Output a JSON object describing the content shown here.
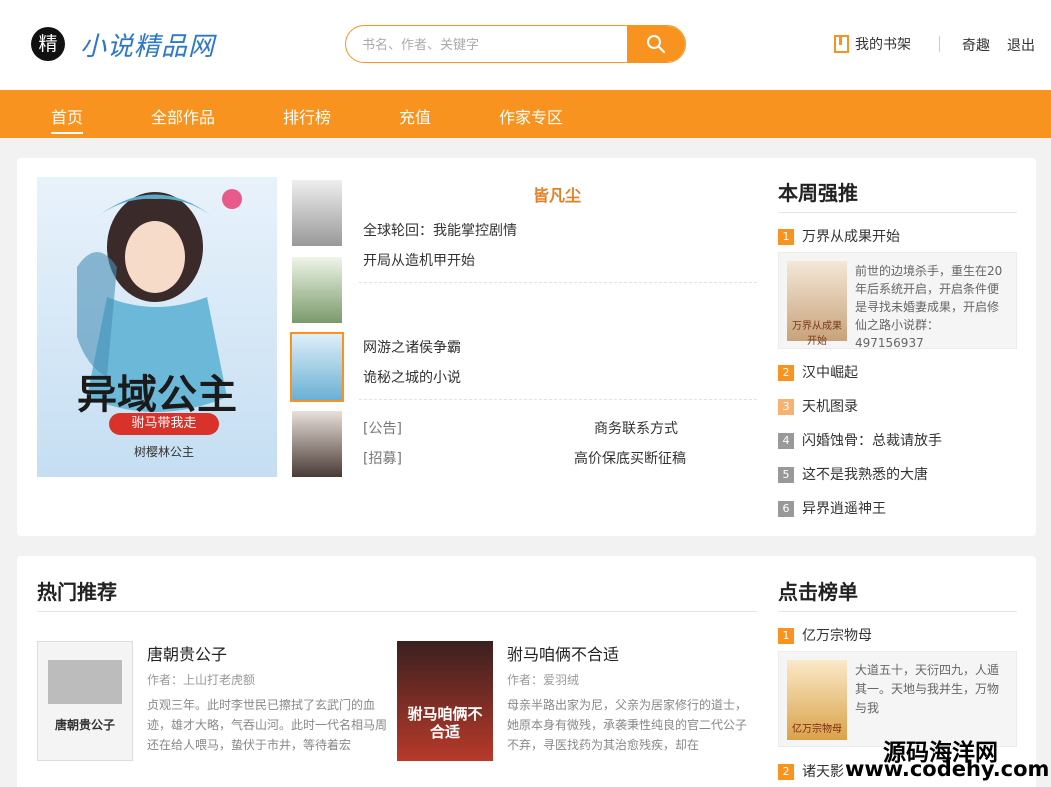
{
  "header": {
    "logo_char": "精",
    "site_name": "小说精品网",
    "search_placeholder": "书名、作者、关键字",
    "shelf_label": "我的书架",
    "username": "奇趣",
    "logout_label": "退出"
  },
  "nav": {
    "items": [
      "首页",
      "全部作品",
      "排行榜",
      "充值",
      "作家专区"
    ],
    "active": "首页"
  },
  "featured": {
    "title": "皆凡尘",
    "lines": [
      "全球轮回：我能掌控剧情",
      "开局从造机甲开始",
      "网游之诸侯争霸",
      "诡秘之城的小说",
      "[公告]",
      "商务联系方式",
      "[招募]",
      "高价保底买断征稿"
    ],
    "cover_text": "异域公主",
    "cover_subtitle": "驸马带我走",
    "cover_author": "树樱林公主"
  },
  "weekly": {
    "title": "本周强推",
    "items": [
      {
        "rank": "1",
        "name": "万界从成果开始",
        "desc": "前世的边境杀手，重生在20年后系统开启，开启条件便是寻找未婚妻成果，开启修仙之路小说群：497156937",
        "cover_text": "万界从成果开始"
      },
      {
        "rank": "2",
        "name": "汉中崛起"
      },
      {
        "rank": "3",
        "name": "天机图录"
      },
      {
        "rank": "4",
        "name": "闪婚蚀骨：总裁请放手"
      },
      {
        "rank": "5",
        "name": "这不是我熟悉的大唐"
      },
      {
        "rank": "6",
        "name": "异界逍遥神王"
      }
    ]
  },
  "hot": {
    "title": "热门推荐",
    "books": [
      {
        "name": "唐朝贵公子",
        "author": "作者：上山打老虎额",
        "desc": "贞观三年。此时李世民已擦拭了玄武门的血迹，雄才大略，气吞山河。此时一代名相马周还在给人喂马，蛰伏于市井，等待着宏",
        "cover_text": "唐朝贵公子"
      },
      {
        "name": "驸马咱俩不合适",
        "author": "作者：爱羽绒",
        "desc": "母亲半路出家为尼，父亲为居家修行的道士，她原本身有微残，承袭秉性纯良的官二代公子不弃，寻医找药为其治愈残疾，却在",
        "cover_text": "驸马咱俩不合适"
      }
    ]
  },
  "clicks": {
    "title": "点击榜单",
    "items": [
      {
        "rank": "1",
        "name": "亿万宗物母",
        "desc": "大道五十，天衍四九，人遁其一。天地与我并生，万物与我",
        "cover_text": "亿万宗物母"
      },
      {
        "rank": "2",
        "name": "诸天影"
      }
    ]
  },
  "watermark": {
    "line1": "源码海洋网",
    "line2": "www.codehy.com"
  }
}
